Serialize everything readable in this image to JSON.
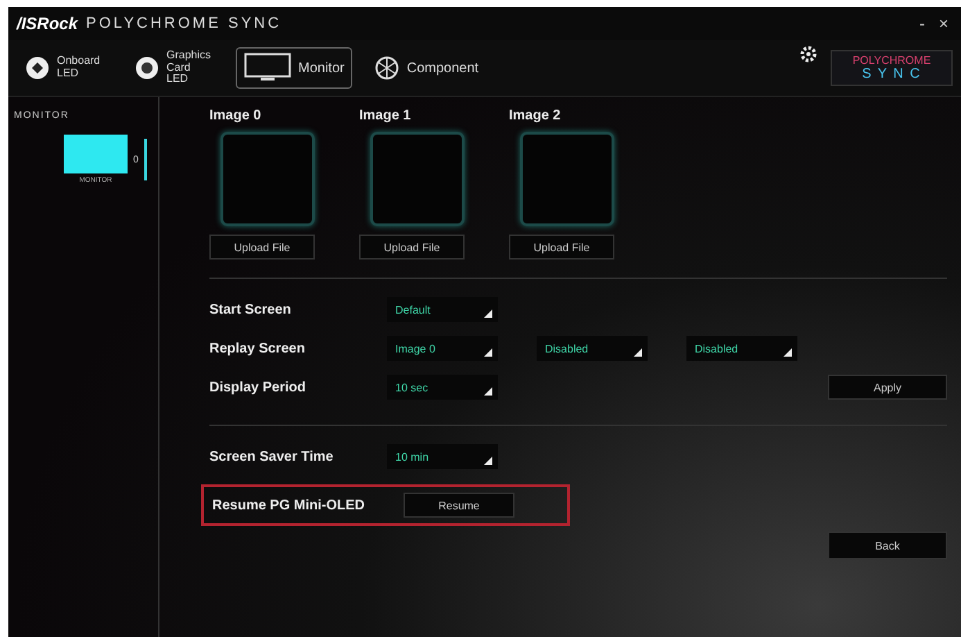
{
  "window": {
    "brand": "/ISRock",
    "title": "POLYCHROME SYNC",
    "controls": [
      "-",
      "×"
    ]
  },
  "nav": [
    {
      "kind": "led",
      "label": "Onboard LED",
      "selected": false
    },
    {
      "kind": "gpu",
      "label": "Graphics Card LED",
      "selected": false
    },
    {
      "kind": "monitor",
      "label": "Monitor",
      "selected": true
    },
    {
      "kind": "component",
      "label": "Component",
      "selected": false
    }
  ],
  "logo": {
    "top": "POLYCHROME",
    "bottom": "S Y N C"
  },
  "sidebar": {
    "title": "MONITOR",
    "items": [
      {
        "label": "MONITOR",
        "index": "0",
        "selected": true
      }
    ]
  },
  "images": [
    {
      "title": "Image 0",
      "button": "Upload File"
    },
    {
      "title": "Image 1",
      "button": "Upload File"
    },
    {
      "title": "Image 2",
      "button": "Upload File"
    }
  ],
  "settings": [
    {
      "label": "Start Screen",
      "values": [
        "Default"
      ]
    },
    {
      "label": "Replay Screen",
      "values": [
        "Image 0",
        "Disabled",
        "Disabled"
      ]
    },
    {
      "label": "Display Period",
      "values": [
        "10 sec"
      ],
      "button": "Apply"
    }
  ],
  "saver": {
    "label": "Screen Saver Time",
    "value": "10 min"
  },
  "resume": {
    "label": "Resume PG Mini-OLED",
    "button": "Resume",
    "highlighted": true
  },
  "back": "Back"
}
